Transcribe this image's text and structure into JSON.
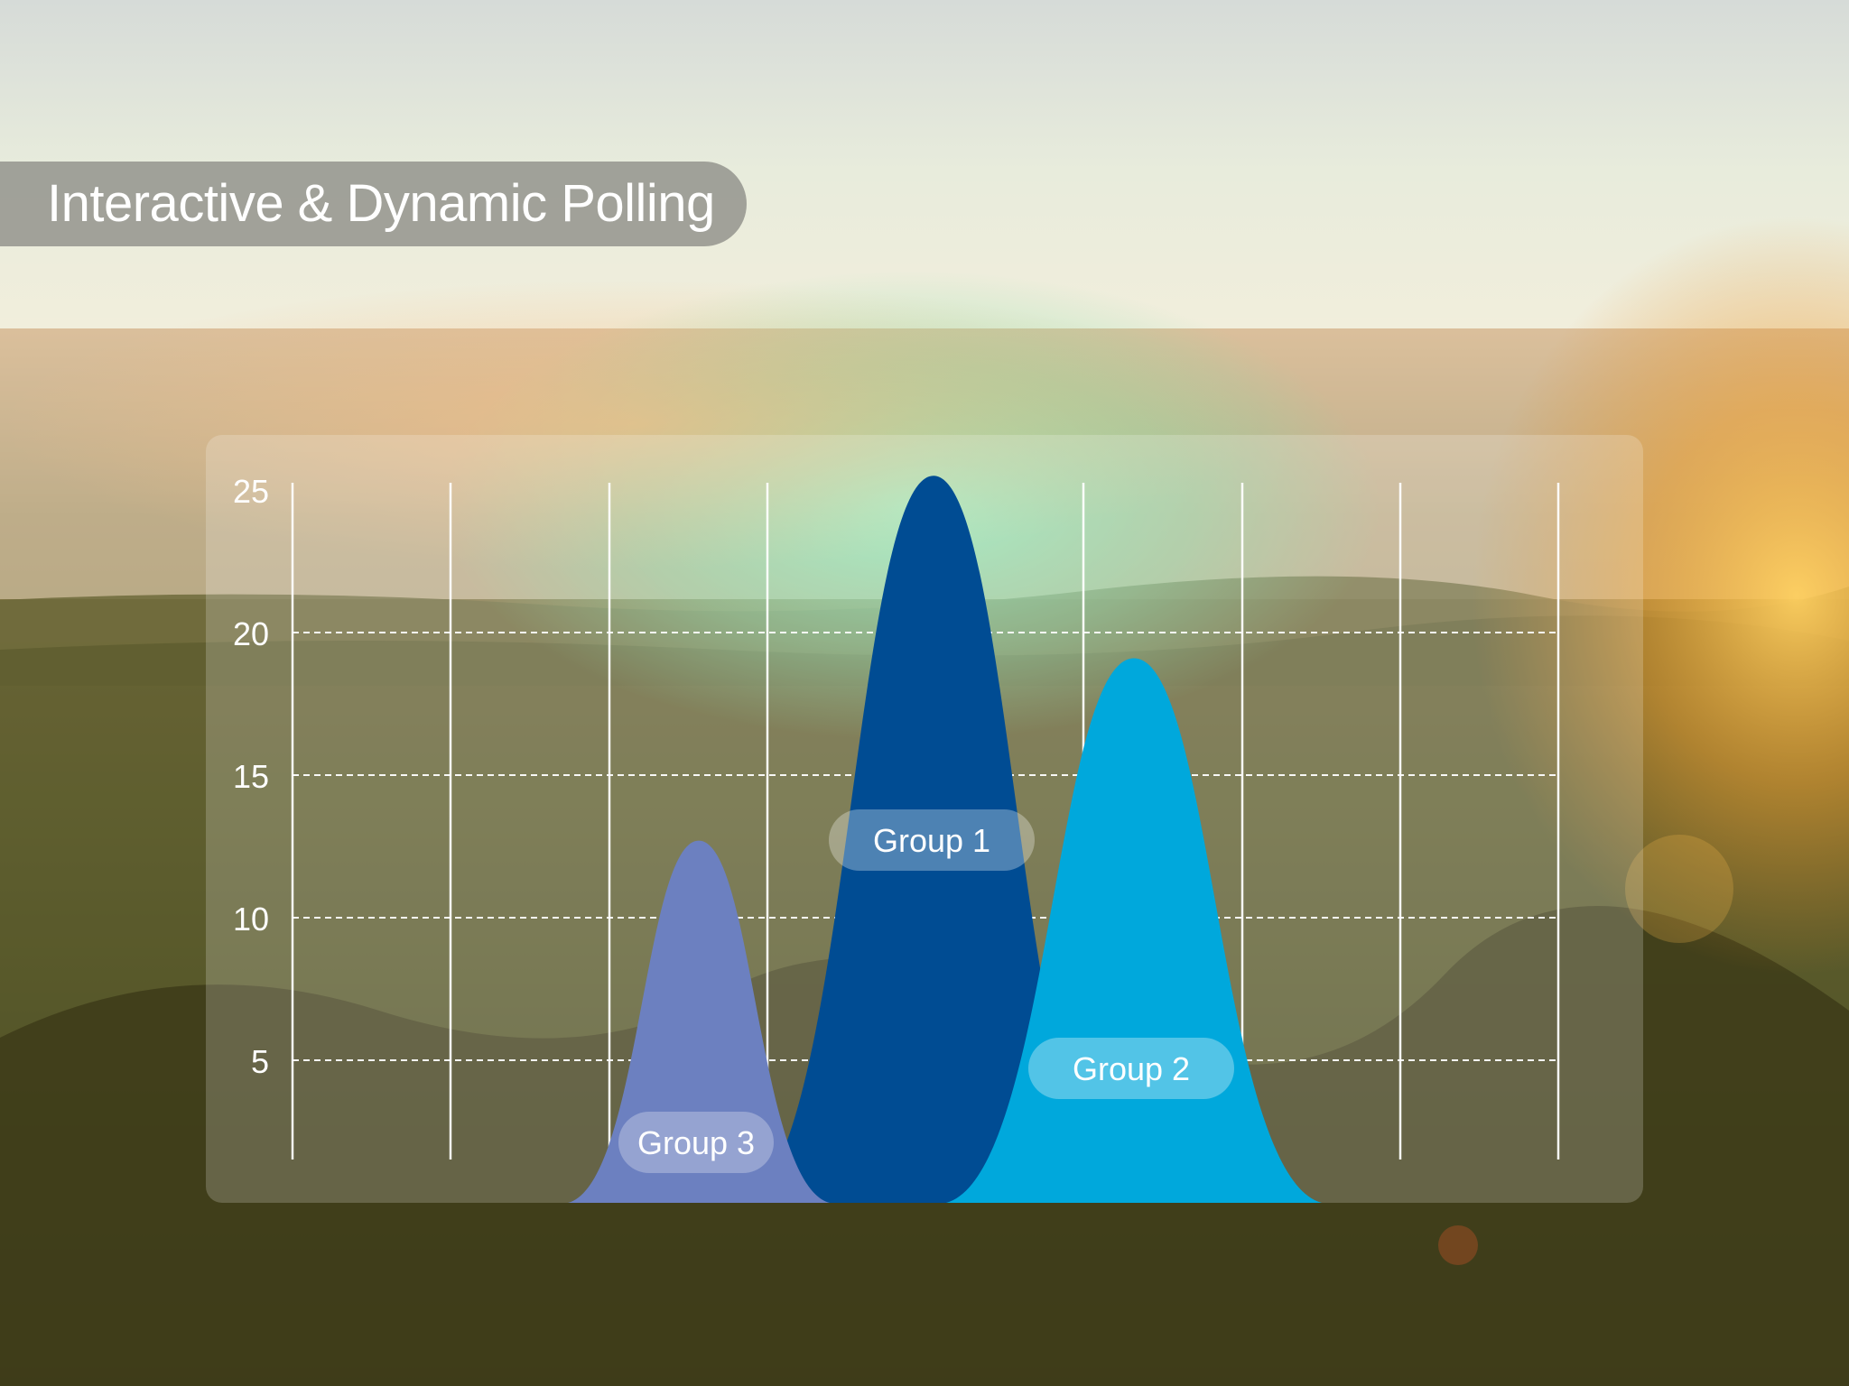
{
  "title": "Interactive & Dynamic Polling",
  "colors": {
    "group1": "#004c93",
    "group2": "#00a8dc",
    "group3": "#6c80c0"
  },
  "chart_data": {
    "type": "area",
    "title": "",
    "xlabel": "",
    "ylabel": "",
    "ylim": [
      0,
      25
    ],
    "yticks": [
      5,
      10,
      15,
      20,
      25
    ],
    "grid": {
      "horizontal": true,
      "vertical": true
    },
    "series": [
      {
        "name": "Group 3",
        "shape": "bell",
        "peak": 12.7,
        "color": "#6c80c0"
      },
      {
        "name": "Group 1",
        "shape": "bell",
        "peak": 25.5,
        "color": "#004c93"
      },
      {
        "name": "Group 2",
        "shape": "bell",
        "peak": 19.1,
        "color": "#00a8dc"
      }
    ]
  }
}
